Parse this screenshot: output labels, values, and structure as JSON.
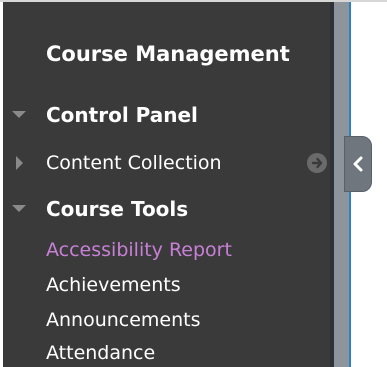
{
  "sidebar": {
    "title": "Course Management",
    "sections": [
      {
        "label": "Control Panel",
        "expanded": true,
        "caret_icon": "caret-down-icon"
      },
      {
        "label": "Content Collection",
        "expanded": false,
        "caret_icon": "caret-right-icon",
        "action_icon": "arrow-right-circle-icon"
      },
      {
        "label": "Course Tools",
        "expanded": true,
        "caret_icon": "caret-down-icon",
        "items": [
          {
            "label": "Accessibility Report",
            "active": true
          },
          {
            "label": "Achievements"
          },
          {
            "label": "Announcements"
          },
          {
            "label": "Attendance"
          }
        ]
      }
    ]
  },
  "collapse_tab": {
    "icon": "chevron-left-icon"
  },
  "colors": {
    "sidebar_bg": "#3a3a3a",
    "text": "#ffffff",
    "active_link": "#c780d6",
    "accent_blue": "#2d7fc8"
  }
}
